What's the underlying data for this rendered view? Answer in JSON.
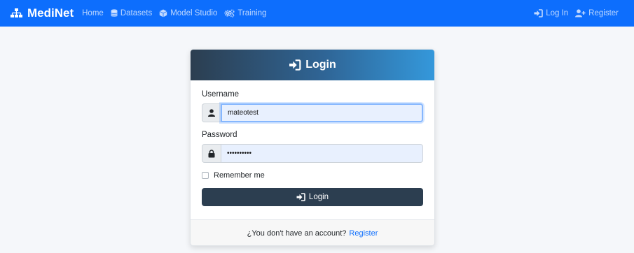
{
  "navbar": {
    "brand": "MediNet",
    "links": [
      {
        "label": "Home",
        "icon": "none"
      },
      {
        "label": "Datasets",
        "icon": "database-icon"
      },
      {
        "label": "Model Studio",
        "icon": "cube-icon"
      },
      {
        "label": "Training",
        "icon": "cogs-icon"
      }
    ],
    "login": "Log In",
    "register": "Register"
  },
  "card": {
    "title": "Login",
    "username_label": "Username",
    "username_value": "mateotest",
    "password_label": "Password",
    "password_value": "••••••••••",
    "remember_label": "Remember me",
    "submit_label": "Login",
    "footer_text": "¿You don't have an account?",
    "footer_link": "Register"
  },
  "colors": {
    "navbar": "#0d6efd",
    "button": "#2c3e50",
    "header_gradient_start": "#2c3e50",
    "header_gradient_end": "#3498db"
  }
}
